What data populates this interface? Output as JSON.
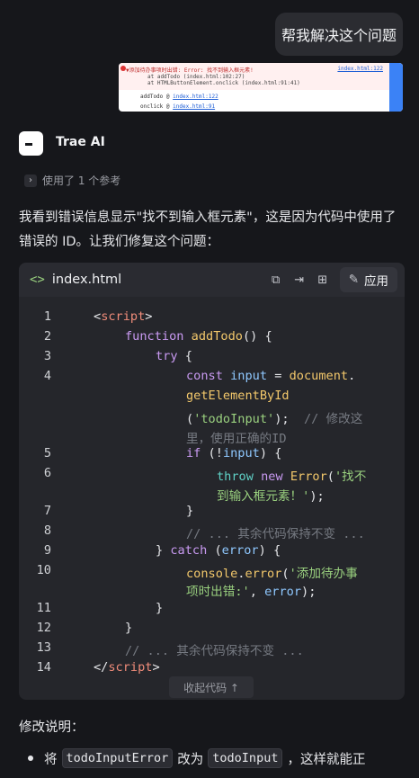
{
  "user_message": "帮我解决这个问题",
  "attachment": {
    "error_line": "▼添加待办事项时出错: Error: 找不到输入框元素!",
    "file_ref_top": "index.html:122",
    "stack1": "at addTodo (index.html:102:27)",
    "stack2": "at HTMLButtonElement.onclick (index.html:91:41)",
    "line3_label": "addTodo @",
    "line3_link": "index.html:122",
    "line4_label": "onclick @",
    "line4_link": "index.html:91"
  },
  "assistant": {
    "name": "Trae AI",
    "references": "使用了 1 个参考",
    "intro": "我看到错误信息显示\"找不到输入框元素\"，这是因为代码中使用了错误的 ID。让我们修复这个问题："
  },
  "code_block": {
    "filename": "index.html",
    "apply_label": "应用",
    "collapse_label": "收起代码 ↑",
    "line_numbers": [
      "1",
      "2",
      "3",
      "4",
      "5",
      "6",
      "7",
      "8",
      "9",
      "10",
      "11",
      "12",
      "13",
      "14"
    ]
  },
  "explanation": {
    "heading": "修改说明：",
    "bullet_prefix": "将",
    "old_id": "todoInputError",
    "middle": "改为",
    "new_id": "todoInput",
    "suffix": "，这样就能正"
  }
}
